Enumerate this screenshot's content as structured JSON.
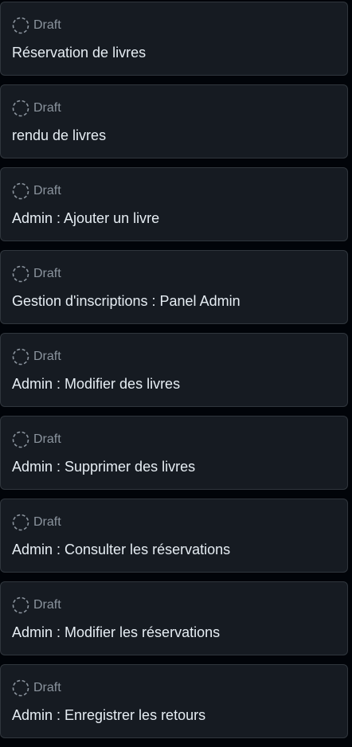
{
  "colors": {
    "background": "#010409",
    "card_background": "#161b22",
    "card_border": "#30363d",
    "status_text": "#8b949e",
    "title_text": "#e6edf3"
  },
  "cards": [
    {
      "status": "Draft",
      "status_icon": "draft-circle-icon",
      "title": "Réservation de livres"
    },
    {
      "status": "Draft",
      "status_icon": "draft-circle-icon",
      "title": "rendu de livres"
    },
    {
      "status": "Draft",
      "status_icon": "draft-circle-icon",
      "title": "Admin : Ajouter un livre"
    },
    {
      "status": "Draft",
      "status_icon": "draft-circle-icon",
      "title": "Gestion d'inscriptions : Panel Admin"
    },
    {
      "status": "Draft",
      "status_icon": "draft-circle-icon",
      "title": "Admin : Modifier des livres"
    },
    {
      "status": "Draft",
      "status_icon": "draft-circle-icon",
      "title": "Admin : Supprimer des livres"
    },
    {
      "status": "Draft",
      "status_icon": "draft-circle-icon",
      "title": "Admin : Consulter les réservations"
    },
    {
      "status": "Draft",
      "status_icon": "draft-circle-icon",
      "title": "Admin : Modifier les réservations"
    },
    {
      "status": "Draft",
      "status_icon": "draft-circle-icon",
      "title": "Admin : Enregistrer les retours"
    }
  ]
}
